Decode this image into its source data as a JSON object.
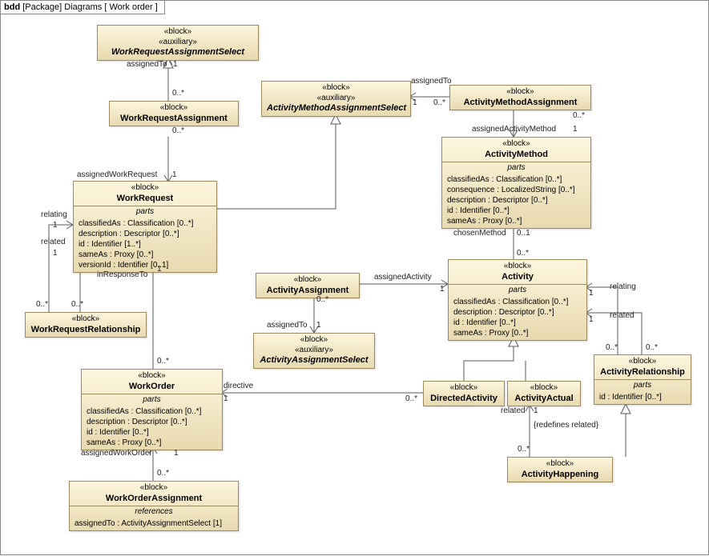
{
  "frame": {
    "prefix": "bdd",
    "package": "[Package] Diagrams",
    "name": "[ Work order ]"
  },
  "blocks": {
    "wras": {
      "stereos": [
        "«block»",
        "«auxiliary»"
      ],
      "name": "WorkRequestAssignmentSelect",
      "italic": true
    },
    "wra": {
      "stereos": [
        "«block»"
      ],
      "name": "WorkRequestAssignment"
    },
    "amas": {
      "stereos": [
        "«block»",
        "«auxiliary»"
      ],
      "name": "ActivityMethodAssignmentSelect",
      "italic": true
    },
    "ama": {
      "stereos": [
        "«block»"
      ],
      "name": "ActivityMethodAssignment"
    },
    "am": {
      "stereos": [
        "«block»"
      ],
      "name": "ActivityMethod",
      "sectionTitle": "parts",
      "parts": [
        "classifiedAs : Classification [0..*]",
        "consequence : LocalizedString [0..*]",
        "description : Descriptor [0..*]",
        "id : Identifier [0..*]",
        "sameAs : Proxy [0..*]"
      ]
    },
    "wr": {
      "stereos": [
        "«block»"
      ],
      "name": "WorkRequest",
      "sectionTitle": "parts",
      "parts": [
        "classifiedAs : Classification [0..*]",
        "description : Descriptor [0..*]",
        "id : Identifier [1..*]",
        "sameAs : Proxy [0..*]",
        "versionId : Identifier [0..1]"
      ]
    },
    "wrr": {
      "stereos": [
        "«block»"
      ],
      "name": "WorkRequestRelationship"
    },
    "aa": {
      "stereos": [
        "«block»"
      ],
      "name": "ActivityAssignment"
    },
    "aas": {
      "stereos": [
        "«block»",
        "«auxiliary»"
      ],
      "name": "ActivityAssignmentSelect",
      "italic": true
    },
    "act": {
      "stereos": [
        "«block»"
      ],
      "name": "Activity",
      "sectionTitle": "parts",
      "parts": [
        "classifiedAs : Classification [0..*]",
        "description : Descriptor [0..*]",
        "id : Identifier [0..*]",
        "sameAs : Proxy [0..*]"
      ]
    },
    "ar": {
      "stereos": [
        "«block»"
      ],
      "name": "ActivityRelationship",
      "sectionTitle": "parts",
      "parts": [
        "id : Identifier [0..*]"
      ]
    },
    "wo": {
      "stereos": [
        "«block»"
      ],
      "name": "WorkOrder",
      "sectionTitle": "parts",
      "parts": [
        "classifiedAs : Classification [0..*]",
        "description : Descriptor [0..*]",
        "id : Identifier [0..*]",
        "sameAs : Proxy [0..*]"
      ]
    },
    "da": {
      "stereos": [
        "«block»"
      ],
      "name": "DirectedActivity"
    },
    "aact": {
      "stereos": [
        "«block»"
      ],
      "name": "ActivityActual"
    },
    "ah": {
      "stereos": [
        "«block»"
      ],
      "name": "ActivityHappening"
    },
    "woa": {
      "stereos": [
        "«block»"
      ],
      "name": "WorkOrderAssignment",
      "sectionTitle": "references",
      "parts": [
        "assignedTo : ActivityAssignmentSelect [1]"
      ]
    }
  },
  "labels": {
    "wras_assignedTo": "assignedTo",
    "wras_m1": "1",
    "wra_m": "0..*",
    "wr_assignedWorkRequest": "assignedWorkRequest",
    "wr_m1": "1",
    "amas_assignedTo": "assignedTo",
    "amas_m1": "1",
    "ama_m": "0..*",
    "am_assignedActivityMethod": "assignedActivityMethod",
    "am_m1": "1",
    "am_chosenMethod": "chosenMethod",
    "am_m01": "0..1",
    "act_m0s": "0..*",
    "act_relating": "relating",
    "act_relating_m1": "1",
    "act_related": "related",
    "act_related_m1": "1",
    "ar_m0s_a": "0..*",
    "ar_m0s_b": "0..*",
    "aa_assignedActivity": "assignedActivity",
    "aa_m1": "1",
    "aa_m0s": "0..*",
    "aa_assignedTo": "assignedTo",
    "aas_m1": "1",
    "wrr_relating": "relating",
    "wrr_relating_m1": "1",
    "wrr_related": "related",
    "wrr_related_m1": "1",
    "wrr_m0s_a": "0..*",
    "wrr_m0s_b": "0..*",
    "wr_inResponseTo": "inResponseTo",
    "wr_inResponseTo_m0s": "0..*",
    "wo_directive": "directive",
    "wo_m1": "1",
    "da_m0s": "0..*",
    "wo_assignedWorkOrder": "assignedWorkOrder",
    "wo_awo_m1": "1",
    "woa_m0s": "0..*",
    "aact_related": "related",
    "aact_m1": "1",
    "ah_constraint": "{redefines related}",
    "ah_m0s": "0..*"
  },
  "chart_data": {
    "type": "table",
    "diagram_kind": "SysML bdd (block definition diagram)",
    "package": "Diagrams",
    "frame_name": "Work order",
    "blocks": [
      {
        "name": "WorkRequestAssignmentSelect",
        "stereotypes": [
          "block",
          "auxiliary"
        ],
        "abstract": true
      },
      {
        "name": "WorkRequestAssignment",
        "stereotypes": [
          "block"
        ]
      },
      {
        "name": "ActivityMethodAssignmentSelect",
        "stereotypes": [
          "block",
          "auxiliary"
        ],
        "abstract": true
      },
      {
        "name": "ActivityMethodAssignment",
        "stereotypes": [
          "block"
        ]
      },
      {
        "name": "ActivityMethod",
        "stereotypes": [
          "block"
        ],
        "parts": [
          "classifiedAs : Classification [0..*]",
          "consequence : LocalizedString [0..*]",
          "description : Descriptor [0..*]",
          "id : Identifier [0..*]",
          "sameAs : Proxy [0..*]"
        ]
      },
      {
        "name": "WorkRequest",
        "stereotypes": [
          "block"
        ],
        "parts": [
          "classifiedAs : Classification [0..*]",
          "description : Descriptor [0..*]",
          "id : Identifier [1..*]",
          "sameAs : Proxy [0..*]",
          "versionId : Identifier [0..1]"
        ]
      },
      {
        "name": "WorkRequestRelationship",
        "stereotypes": [
          "block"
        ]
      },
      {
        "name": "ActivityAssignment",
        "stereotypes": [
          "block"
        ]
      },
      {
        "name": "ActivityAssignmentSelect",
        "stereotypes": [
          "block",
          "auxiliary"
        ],
        "abstract": true
      },
      {
        "name": "Activity",
        "stereotypes": [
          "block"
        ],
        "parts": [
          "classifiedAs : Classification [0..*]",
          "description : Descriptor [0..*]",
          "id : Identifier [0..*]",
          "sameAs : Proxy [0..*]"
        ]
      },
      {
        "name": "ActivityRelationship",
        "stereotypes": [
          "block"
        ],
        "parts": [
          "id : Identifier [0..*]"
        ]
      },
      {
        "name": "WorkOrder",
        "stereotypes": [
          "block"
        ],
        "parts": [
          "classifiedAs : Classification [0..*]",
          "description : Descriptor [0..*]",
          "id : Identifier [0..*]",
          "sameAs : Proxy [0..*]"
        ]
      },
      {
        "name": "DirectedActivity",
        "stereotypes": [
          "block"
        ]
      },
      {
        "name": "ActivityActual",
        "stereotypes": [
          "block"
        ]
      },
      {
        "name": "ActivityHappening",
        "stereotypes": [
          "block"
        ]
      },
      {
        "name": "WorkOrderAssignment",
        "stereotypes": [
          "block"
        ],
        "references": [
          "assignedTo : ActivityAssignmentSelect [1]"
        ]
      }
    ],
    "generalizations": [
      {
        "child": "WorkRequest",
        "parent": "WorkRequestAssignmentSelect"
      },
      {
        "child": "WorkRequest",
        "parent": "ActivityMethodAssignmentSelect"
      },
      {
        "child": "DirectedActivity",
        "parent": "Activity"
      },
      {
        "child": "ActivityActual",
        "parent": "Activity"
      },
      {
        "child": "ActivityHappening",
        "parent": "ActivityRelationship"
      }
    ],
    "associations": [
      {
        "from": "WorkRequestAssignment",
        "to": "WorkRequestAssignmentSelect",
        "fromMult": "0..*",
        "toRole": "assignedTo",
        "toMult": "1"
      },
      {
        "from": "WorkRequestAssignment",
        "to": "WorkRequest",
        "fromMult": "0..*",
        "toRole": "assignedWorkRequest",
        "toMult": "1"
      },
      {
        "from": "ActivityMethodAssignment",
        "to": "ActivityMethodAssignmentSelect",
        "fromMult": "0..*",
        "toRole": "assignedTo",
        "toMult": "1"
      },
      {
        "from": "ActivityMethodAssignment",
        "to": "ActivityMethod",
        "fromMult": "0..*",
        "toRole": "assignedActivityMethod",
        "toMult": "1"
      },
      {
        "from": "Activity",
        "to": "ActivityMethod",
        "fromMult": "0..*",
        "toRole": "chosenMethod",
        "toMult": "0..1"
      },
      {
        "from": "ActivityAssignment",
        "to": "Activity",
        "fromMult": "0..*",
        "toRole": "assignedActivity",
        "toMult": "1"
      },
      {
        "from": "ActivityAssignment",
        "to": "ActivityAssignmentSelect",
        "fromMult": "0..*",
        "toRole": "assignedTo",
        "toMult": "1"
      },
      {
        "from": "WorkRequestRelationship",
        "to": "WorkRequest",
        "fromMult": "0..*",
        "toRole": "relating",
        "toMult": "1"
      },
      {
        "from": "WorkRequestRelationship",
        "to": "WorkRequest",
        "fromMult": "0..*",
        "toRole": "related",
        "toMult": "1"
      },
      {
        "from": "WorkOrder",
        "to": "WorkRequest",
        "fromMult": "0..*",
        "toRole": "inResponseTo",
        "toMult": "1"
      },
      {
        "from": "DirectedActivity",
        "to": "WorkOrder",
        "fromMult": "0..*",
        "toRole": "directive",
        "toMult": "1"
      },
      {
        "from": "WorkOrderAssignment",
        "to": "WorkOrder",
        "fromMult": "0..*",
        "toRole": "assignedWorkOrder",
        "toMult": "1"
      },
      {
        "from": "ActivityRelationship",
        "to": "Activity",
        "fromMult": "0..*",
        "toRole": "relating",
        "toMult": "1"
      },
      {
        "from": "ActivityRelationship",
        "to": "Activity",
        "fromMult": "0..*",
        "toRole": "related",
        "toMult": "1"
      },
      {
        "from": "ActivityHappening",
        "to": "ActivityActual",
        "fromMult": "0..*",
        "toRole": "related",
        "toMult": "1",
        "constraint": "{redefines related}"
      }
    ]
  }
}
